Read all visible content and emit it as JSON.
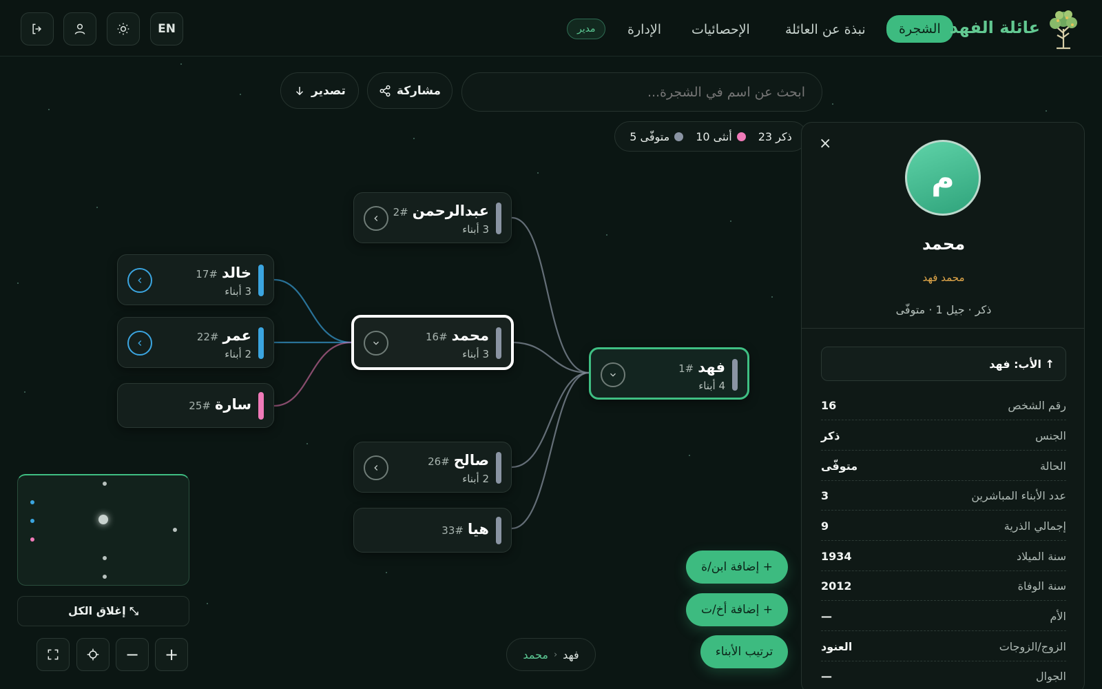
{
  "header": {
    "brand": "عائلة الفهد",
    "nav": [
      {
        "label": "الشجرة",
        "active": true
      },
      {
        "label": "نبذة عن العائلة"
      },
      {
        "label": "الإحصائيات"
      },
      {
        "label": "الإدارة"
      }
    ],
    "admin_badge": "مدير",
    "lang": "EN",
    "icons": [
      "logout-icon",
      "user-icon",
      "sun-icon"
    ]
  },
  "toolbar": {
    "search_placeholder": "ابحث عن اسم في الشجرة...",
    "share_label": "مشاركة",
    "export_label": "تصدير"
  },
  "legend": {
    "male": "ذكر 23",
    "female": "أنثى 10",
    "deceased": "متوفّى 5",
    "colors": {
      "male": "#3ba5e0",
      "female": "#f07ab8",
      "deceased": "#8a94a3"
    }
  },
  "tree": {
    "nodes": [
      {
        "id": "fahd",
        "name": "فهد",
        "num": "#1",
        "kids": "4 أبناء"
      },
      {
        "id": "abdulrahman",
        "name": "عبدالرحمن",
        "num": "#2",
        "kids": "3 أبناء"
      },
      {
        "id": "mohammed",
        "name": "محمد",
        "num": "#16",
        "kids": "3 أبناء"
      },
      {
        "id": "saleh",
        "name": "صالح",
        "num": "#26",
        "kids": "2 أبناء"
      },
      {
        "id": "haya",
        "name": "هيا",
        "num": "#33",
        "kids": ""
      },
      {
        "id": "khaled",
        "name": "خالد",
        "num": "#17",
        "kids": "3 أبناء"
      },
      {
        "id": "omar",
        "name": "عمر",
        "num": "#22",
        "kids": "2 أبناء"
      },
      {
        "id": "sara",
        "name": "سارة",
        "num": "#25",
        "kids": ""
      }
    ]
  },
  "minimap": {
    "collapse_all": "إغلاق الكل ⤡"
  },
  "zoom": {
    "in": "+",
    "out": "−"
  },
  "breadcrumb": {
    "root": "فهد",
    "sep": "‹",
    "current": "محمد"
  },
  "actions": {
    "add_child": "+ إضافة ابن/ة",
    "add_sibling": "+ إضافة أخ/ت",
    "sort_children": "ترتيب الأبناء"
  },
  "panel": {
    "close": "×",
    "avatar_letter": "م",
    "name": "محمد",
    "full_name": "محمد فهد",
    "meta": "ذكر · جيل 1 · متوفّى",
    "father": "↑ الأب: فهد",
    "details": [
      {
        "label": "رقم الشخص",
        "value": "16"
      },
      {
        "label": "الجنس",
        "value": "ذكر"
      },
      {
        "label": "الحالة",
        "value": "متوفّى"
      },
      {
        "label": "عدد الأبناء المباشرين",
        "value": "3"
      },
      {
        "label": "إجمالي الذرية",
        "value": "9"
      },
      {
        "label": "سنة الميلاد",
        "value": "1934"
      },
      {
        "label": "سنة الوفاة",
        "value": "2012"
      },
      {
        "label": "الأم",
        "value": "—"
      },
      {
        "label": "الزوج/الزوجات",
        "value": "العنود"
      },
      {
        "label": "الجوال",
        "value": "—"
      }
    ]
  }
}
